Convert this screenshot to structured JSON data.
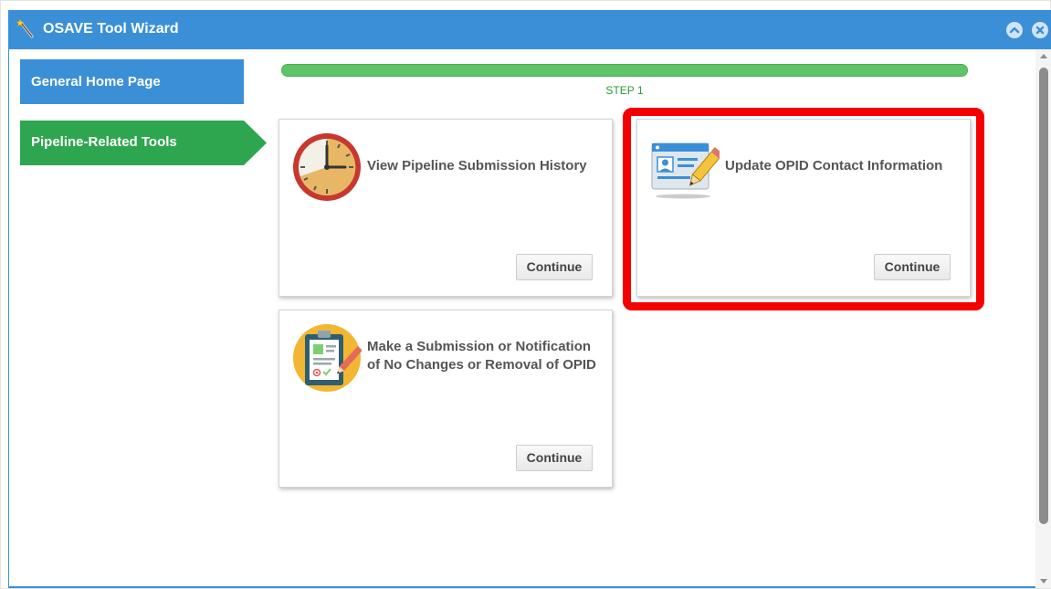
{
  "window": {
    "title": "OSAVE Tool Wizard",
    "title_icon": "magic-wand-icon",
    "collapse_icon": "chevron-up-icon",
    "close_icon": "close-icon"
  },
  "sidebar": {
    "items": [
      {
        "label": "General Home Page",
        "active": false
      },
      {
        "label": "Pipeline-Related Tools",
        "active": true
      }
    ]
  },
  "progress": {
    "value": 1.0,
    "step_label": "STEP 1"
  },
  "cards": [
    {
      "title": "View Pipeline Submission History",
      "icon": "clock-icon",
      "button_label": "Continue"
    },
    {
      "title": "Update OPID Contact Information",
      "icon": "contact-card-edit-icon",
      "button_label": "Continue",
      "highlighted": true
    },
    {
      "title": "Make a Submission or Notification of No Changes or Removal of OPID",
      "icon": "clipboard-checklist-icon",
      "button_label": "Continue"
    }
  ],
  "colors": {
    "title_bar": "#3b8fd6",
    "nav_active": "#2ea64f",
    "progress": "#5fc468",
    "highlight": "#f50000"
  }
}
